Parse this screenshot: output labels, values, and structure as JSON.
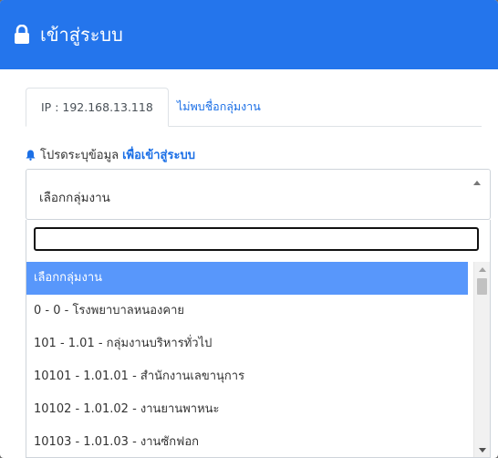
{
  "header": {
    "title": "เข้าสู่ระบบ",
    "icon": "lock-icon",
    "color": "#2475ec"
  },
  "tabs": [
    {
      "label": "IP : 192.168.13.118",
      "active": true
    },
    {
      "label": "ไม่พบชื่อกลุ่มงาน",
      "active": false
    }
  ],
  "hint": {
    "icon": "bell-icon",
    "text": "โปรดระบุข้อมูล",
    "accent": "เพื่อเข้าสู่ระบบ"
  },
  "select": {
    "value": "เลือกกลุ่มงาน",
    "search_value": ""
  },
  "options": [
    "เลือกกลุ่มงาน",
    "0 - 0 - โรงพยาบาลหนองคาย",
    "101 - 1.01 - กลุ่มงานบริหารทั่วไป",
    "10101 - 1.01.01 - สำนักงานเลขานุการ",
    "10102 - 1.01.02 - งานยานพาหนะ",
    "10103 - 1.01.03 - งานซักฟอก"
  ]
}
